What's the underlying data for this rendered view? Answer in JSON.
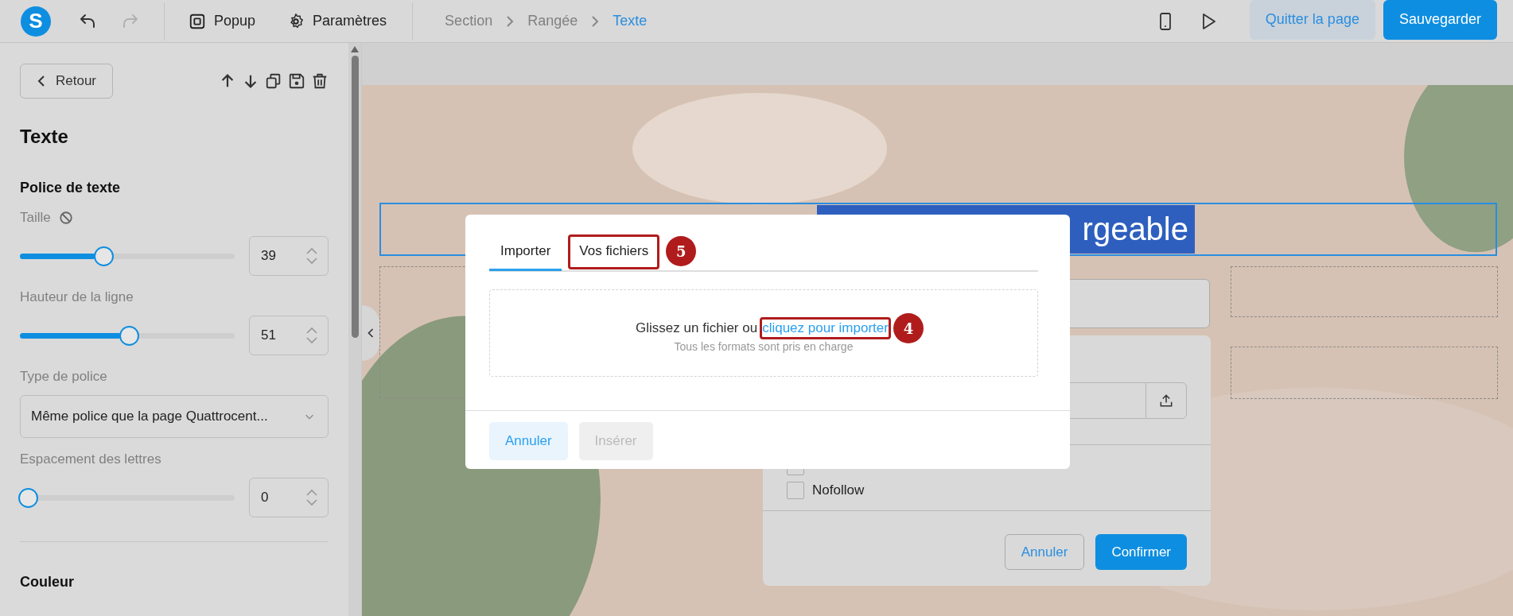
{
  "toolbar": {
    "logo_letter": "S",
    "undo_disabled": false,
    "redo_disabled": true,
    "buttons": [
      {
        "kind": "popup",
        "label": "Popup"
      },
      {
        "kind": "settings",
        "label": "Paramètres"
      }
    ],
    "breadcrumb": [
      {
        "label": "Section",
        "selected": false
      },
      {
        "label": "Rangée",
        "selected": false
      },
      {
        "label": "Texte",
        "selected": true
      }
    ],
    "quit_label": "Quitter la page",
    "save_label": "Sauvegarder"
  },
  "panel": {
    "back_label": "Retour",
    "title": "Texte",
    "section_title": "Police de texte",
    "controls": [
      {
        "kind": "slider",
        "label": "Taille",
        "reset_icon": true,
        "level": 0.35,
        "value": "39"
      },
      {
        "kind": "slider",
        "label": "Hauteur de la ligne",
        "reset_icon": false,
        "level": 0.47,
        "value": "51"
      },
      {
        "kind": "select",
        "label": "Type de police",
        "value": "Même police que la page Quattrocent..."
      },
      {
        "kind": "slider",
        "label": "Espacement des lettres",
        "reset_icon": false,
        "level": 0,
        "value": "0"
      }
    ],
    "next_section": "Couleur"
  },
  "canvas": {
    "heading_visible": "rgeable",
    "link_dialog": {
      "checkboxes": [
        {
          "checked": false
        },
        {
          "label": "Nofollow",
          "checked": false
        }
      ],
      "cancel": "Annuler",
      "confirm": "Confirmer"
    }
  },
  "modal": {
    "tabs": [
      {
        "label": "Importer",
        "selected": true
      },
      {
        "label": "Vos fichiers",
        "selected": false,
        "callout": "5"
      }
    ],
    "drop_text": "Glissez un fichier ou",
    "link": "cliquez pour importer",
    "link_callout": "4",
    "hint": "Tous les formats sont pris en charge",
    "cancel": "Annuler",
    "insert": "Insérer",
    "insert_disabled": true
  }
}
